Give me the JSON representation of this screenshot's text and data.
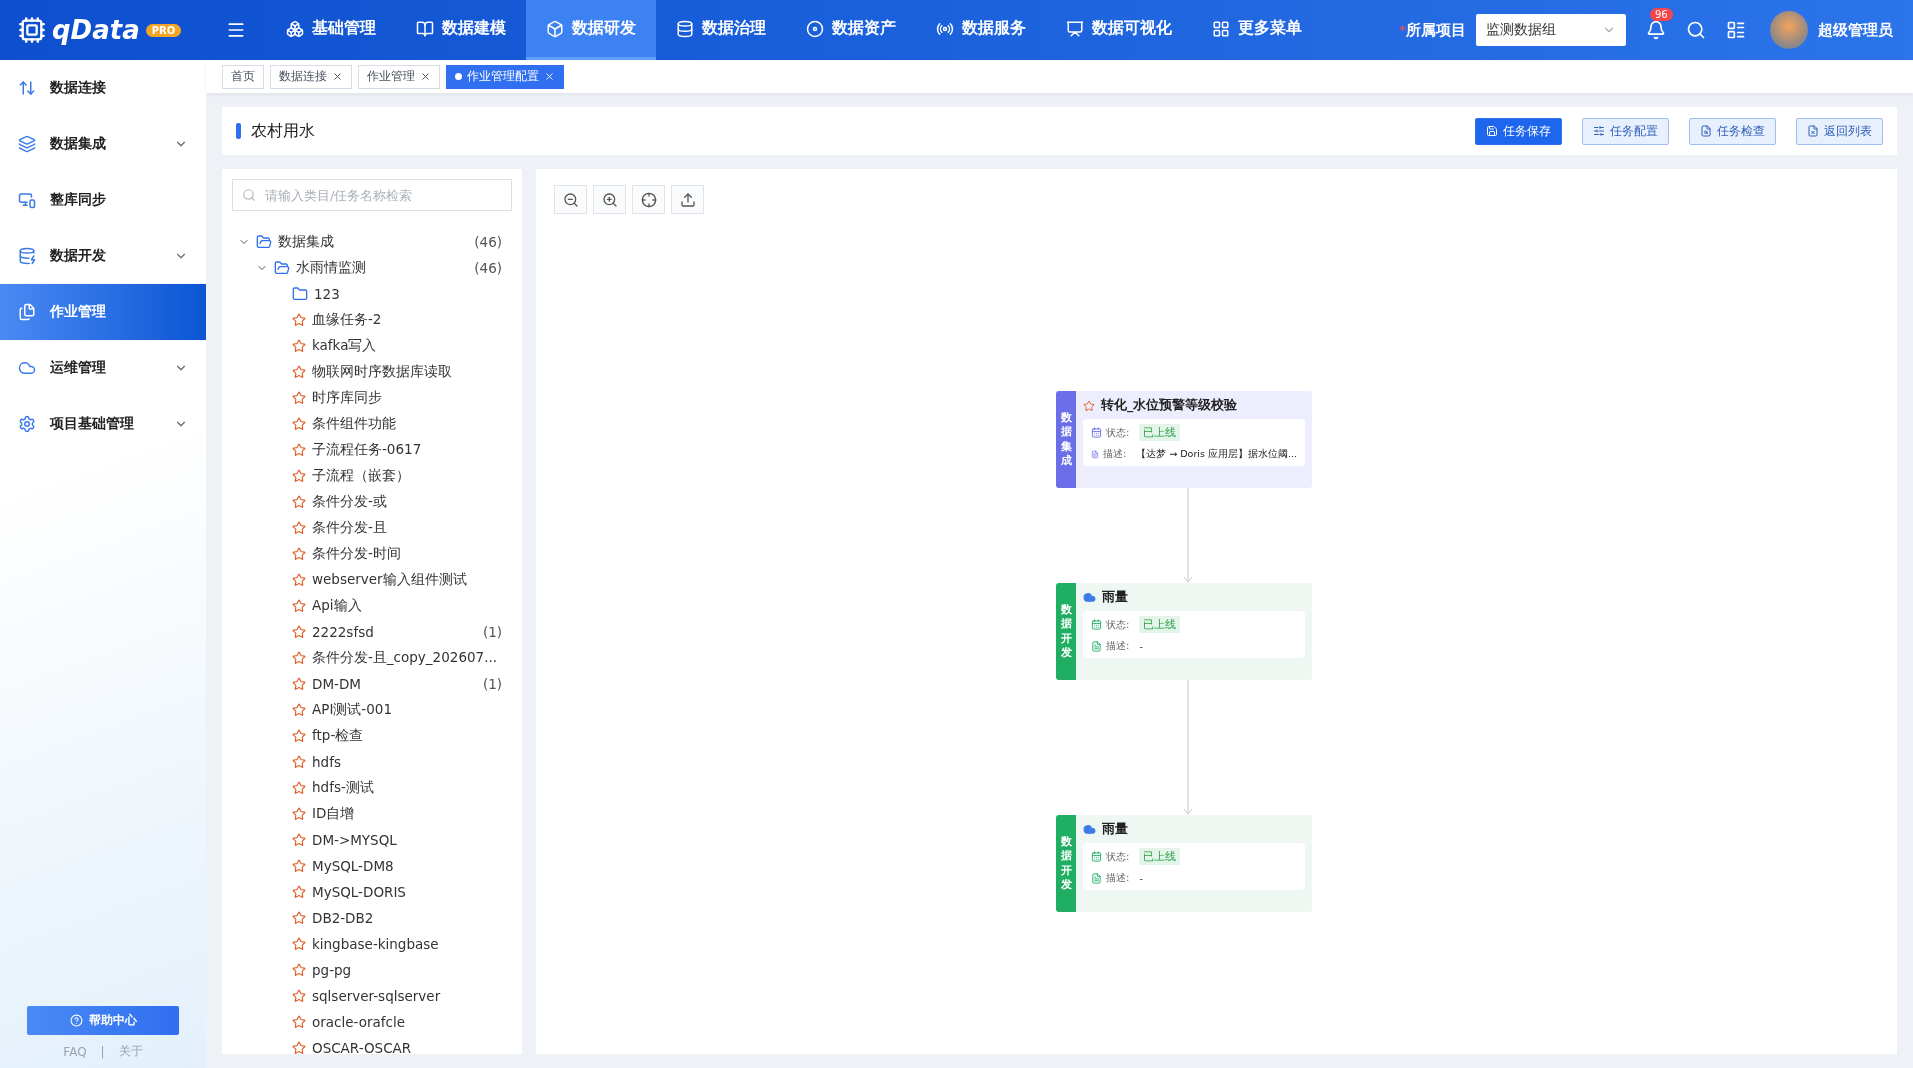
{
  "header": {
    "logo": "qData",
    "logo_badge": "PRO",
    "nav": [
      {
        "label": "基础管理",
        "selected": false
      },
      {
        "label": "数据建模",
        "selected": false
      },
      {
        "label": "数据研发",
        "selected": true
      },
      {
        "label": "数据治理",
        "selected": false
      },
      {
        "label": "数据资产",
        "selected": false
      },
      {
        "label": "数据服务",
        "selected": false
      },
      {
        "label": "数据可视化",
        "selected": false
      },
      {
        "label": "更多菜单",
        "selected": false
      }
    ],
    "project_required_mark": "*",
    "project_label": "所属项目",
    "project_value": "监测数据组",
    "notification_count": "96",
    "user": "超级管理员"
  },
  "sidebar": {
    "items": [
      {
        "label": "数据连接",
        "kind": "link",
        "selected": false
      },
      {
        "label": "数据集成",
        "kind": "group",
        "selected": false
      },
      {
        "label": "整库同步",
        "kind": "link",
        "selected": false
      },
      {
        "label": "数据开发",
        "kind": "group",
        "selected": false
      },
      {
        "label": "作业管理",
        "kind": "link",
        "selected": true
      },
      {
        "label": "运维管理",
        "kind": "group",
        "selected": false
      },
      {
        "label": "项目基础管理",
        "kind": "group",
        "selected": false
      }
    ],
    "help_button": "帮助中心",
    "footer_links": [
      "FAQ",
      "关于"
    ],
    "footer_separator": "|"
  },
  "tabs": [
    {
      "label": "首页",
      "closable": false,
      "selected": false
    },
    {
      "label": "数据连接",
      "closable": true,
      "selected": false
    },
    {
      "label": "作业管理",
      "closable": true,
      "selected": false
    },
    {
      "label": "作业管理配置",
      "closable": true,
      "selected": true
    }
  ],
  "page": {
    "title": "农村用水",
    "actions": [
      {
        "label": "任务保存",
        "primary": true
      },
      {
        "label": "任务配置",
        "primary": false
      },
      {
        "label": "任务检查",
        "primary": false
      },
      {
        "label": "返回列表",
        "primary": false
      }
    ]
  },
  "tree": {
    "placeholder": "请输入类目/任务名称检索",
    "items": [
      {
        "kind": "folder",
        "label": "数据集成",
        "count": "(46)",
        "expanded": true,
        "children": [
          {
            "kind": "folder",
            "label": "水雨情监测",
            "count": "(46)",
            "expanded": true,
            "children": [
              {
                "kind": "folder",
                "label": "123"
              },
              {
                "kind": "task",
                "label": "血缘任务-2"
              },
              {
                "kind": "task",
                "label": "kafka写入"
              },
              {
                "kind": "task",
                "label": "物联网时序数据库读取"
              },
              {
                "kind": "task",
                "label": "时序库同步"
              },
              {
                "kind": "task",
                "label": "条件组件功能"
              },
              {
                "kind": "task",
                "label": "子流程任务-0617"
              },
              {
                "kind": "task",
                "label": "子流程（嵌套）"
              },
              {
                "kind": "task",
                "label": "条件分发-或"
              },
              {
                "kind": "task",
                "label": "条件分发-且"
              },
              {
                "kind": "task",
                "label": "条件分发-时间"
              },
              {
                "kind": "task",
                "label": "webserver输入组件测试"
              },
              {
                "kind": "task",
                "label": "Api输入"
              },
              {
                "kind": "task",
                "label": "2222sfsd",
                "count": "(1)"
              },
              {
                "kind": "task",
                "label": "条件分发-且_copy_202607..."
              },
              {
                "kind": "task",
                "label": "DM-DM",
                "count": "(1)"
              },
              {
                "kind": "task",
                "label": "API测试-001"
              },
              {
                "kind": "task",
                "label": "ftp-检查"
              },
              {
                "kind": "task",
                "label": "hdfs"
              },
              {
                "kind": "task",
                "label": "hdfs-测试"
              },
              {
                "kind": "task",
                "label": "ID自增"
              },
              {
                "kind": "task",
                "label": "DM->MYSQL"
              },
              {
                "kind": "task",
                "label": "MySQL-DM8"
              },
              {
                "kind": "task",
                "label": "MySQL-DORIS"
              },
              {
                "kind": "task",
                "label": "DB2-DB2"
              },
              {
                "kind": "task",
                "label": "kingbase-kingbase"
              },
              {
                "kind": "task",
                "label": "pg-pg"
              },
              {
                "kind": "task",
                "label": "sqlserver-sqlserver"
              },
              {
                "kind": "task",
                "label": "oracle-orafcle"
              },
              {
                "kind": "task",
                "label": "OSCAR-OSCAR"
              }
            ]
          }
        ]
      }
    ]
  },
  "canvas": {
    "nodes": [
      {
        "kind": "integration",
        "category": "数据集成",
        "title": "转化_水位预警等级校验",
        "status_label": "状态:",
        "status": "已上线",
        "desc_label": "描述:",
        "desc": "【达梦 → Doris 应用层】据水位阈..."
      },
      {
        "kind": "develop",
        "category": "数据开发",
        "title": "雨量",
        "status_label": "状态:",
        "status": "已上线",
        "desc_label": "描述:",
        "desc": "-"
      },
      {
        "kind": "develop",
        "category": "数据开发",
        "title": "雨量",
        "status_label": "状态:",
        "status": "已上线",
        "desc_label": "描述:",
        "desc": "-"
      }
    ]
  }
}
